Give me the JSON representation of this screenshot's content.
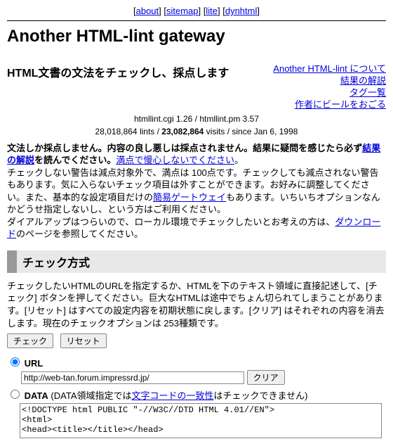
{
  "nav": {
    "about": "about",
    "sitemap": "sitemap",
    "lite": "lite",
    "dynhtml": "dynhtml"
  },
  "title": "Another HTML-lint gateway",
  "subtitle": "HTML文書の文法をチェックし、採点します",
  "right_links": {
    "about": "Another HTML-lint について",
    "result": "結果の解説",
    "tags": "タグ一覧",
    "beer": "作者にビールをおごる"
  },
  "version": "htmllint.cgi 1.26 / htmllint.pm 3.57",
  "stats": {
    "lints": "28,018,864",
    "lints_label": " lints / ",
    "visits": "23,082,864",
    "visits_label": " visits / since Jan 6, 1998"
  },
  "para1": {
    "t1": "文法しか採点しません。内容の良し悪しは採点されません。結果に疑問を感じたら必ず",
    "link_result": "結果の解説",
    "t2": "を読んでください。",
    "link_caution": "満点で慢心しないでください",
    "t3": "。"
  },
  "para2": {
    "t1": "チェックしない警告は減点対象外で、満点は 100点です。チェックしても減点されない警告もあります。気に入らないチェック項目は外すことができます。お好みに調整してください。また、基本的な設定項目だけの",
    "link_easy": "簡易ゲートウェイ",
    "t2": "もあります。いちいちオプションなんかどうせ指定しないし、という方はご利用ください。"
  },
  "para3": {
    "t1": "ダイアルアップはつらいので、ローカル環境でチェックしたいとお考えの方は、",
    "link_download": "ダウンロード",
    "t2": "のページを参照してください。"
  },
  "section_check": "チェック方式",
  "check_desc": "チェックしたいHTMLのURLを指定するか、HTMLを下のテキスト領域に直接記述して、[チェック] ボタンを押してください。巨大なHTMLは途中でちょん切られてしまうことがあります。[リセット] はすべての設定内容を初期状態に戻します。[クリア] はそれぞれの内容を消去します。現在のチェックオプションは 253種類です。",
  "buttons": {
    "check": "チェック",
    "reset": "リセット",
    "clear": "クリア"
  },
  "url": {
    "label": "URL",
    "value": "http://web-tan.forum.impressrd.jp/"
  },
  "data": {
    "label": "DATA",
    "note1": " (DATA領域指定では",
    "note_link": "文字コードの一致性",
    "note2": "はチェックできません)",
    "value": "<!DOCTYPE html PUBLIC \"-//W3C//DTD HTML 4.01//EN\">\n<html>\n<head><title></title></head>"
  }
}
